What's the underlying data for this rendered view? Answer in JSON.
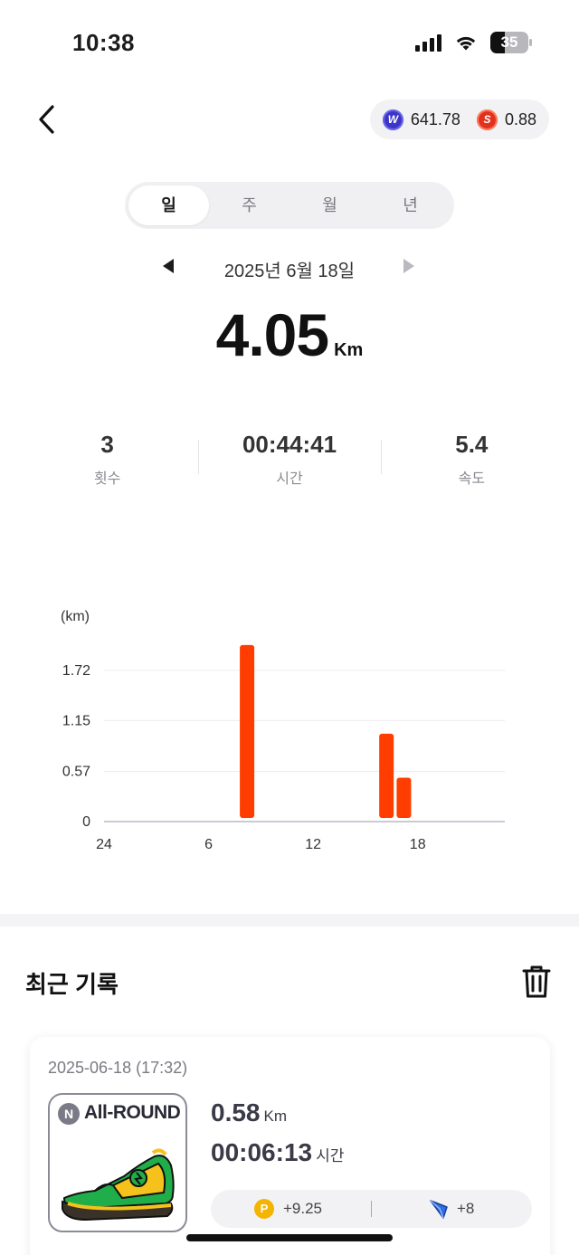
{
  "status_bar": {
    "time": "10:38",
    "battery": "35"
  },
  "header": {
    "coins": [
      {
        "icon": "w-coin-icon",
        "letter": "W",
        "value": "641.78",
        "color": "#3d35c8"
      },
      {
        "icon": "s-coin-icon",
        "letter": "S",
        "value": "0.88",
        "color": "#e0321e"
      }
    ]
  },
  "tabs": [
    {
      "label": "일",
      "active": true
    },
    {
      "label": "주",
      "active": false
    },
    {
      "label": "월",
      "active": false
    },
    {
      "label": "년",
      "active": false
    }
  ],
  "date_nav": {
    "date": "2025년 6월 18일"
  },
  "summary": {
    "distance": "4.05",
    "distance_unit": "Km",
    "stats": [
      {
        "value": "3",
        "label": "횟수"
      },
      {
        "value": "00:44:41",
        "label": "시간"
      },
      {
        "value": "5.4",
        "label": "속도"
      }
    ]
  },
  "chart_data": {
    "type": "bar",
    "unit_label": "(km)",
    "y_ticks": [
      0,
      0.57,
      1.15,
      1.72
    ],
    "y_tick_labels": [
      "0",
      "0.57",
      "1.15",
      "1.72"
    ],
    "ylim": [
      0,
      1.72
    ],
    "x_ticks": [
      0,
      6,
      12,
      18
    ],
    "x_tick_labels": [
      "24",
      "6",
      "12",
      "18"
    ],
    "xlim": [
      0,
      23
    ],
    "bars": [
      {
        "hour": 8,
        "value": 2.01
      },
      {
        "hour": 16,
        "value": 1.0
      },
      {
        "hour": 17,
        "value": 0.5
      }
    ],
    "bar_color": "#ff3d00",
    "grid": true
  },
  "recent": {
    "title": "최근 기록",
    "records": [
      {
        "datetime": "2025-06-18 (17:32)",
        "shoe_badge": "N",
        "shoe_name": "All-ROUND",
        "distance": "0.58",
        "distance_unit": "Km",
        "time": "00:06:13",
        "time_unit": "시간",
        "reward_point_icon": "P",
        "reward_points": "+9.25",
        "reward_gem": "+8"
      }
    ]
  },
  "colors": {
    "accent": "#ff3d00",
    "pill_bg": "#f2f2f4"
  }
}
